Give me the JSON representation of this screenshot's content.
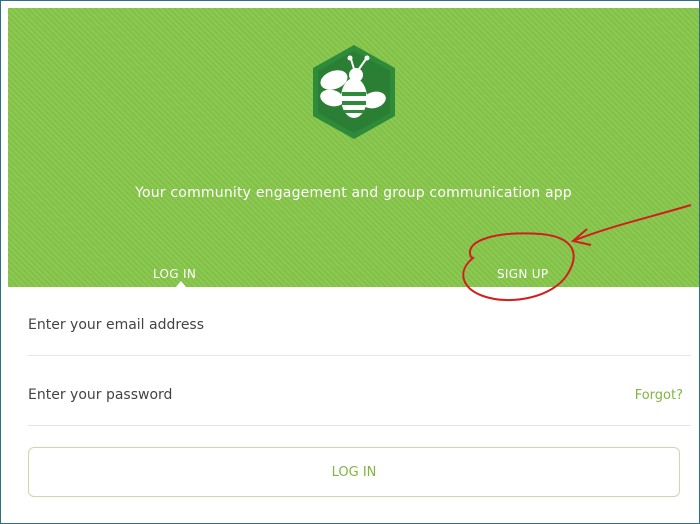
{
  "hero": {
    "tagline": "Your community engagement and group communication app",
    "logo_icon": "bee-hexagon-icon",
    "background_color": "#86c64a"
  },
  "tabs": [
    {
      "label": "LOG IN",
      "active": true
    },
    {
      "label": "SIGN UP",
      "active": false
    }
  ],
  "form": {
    "email_placeholder": "Enter your email address",
    "password_placeholder": "Enter your password",
    "forgot_label": "Forgot?",
    "login_button_label": "LOG IN"
  },
  "annotation": {
    "type": "red-circle-and-arrow",
    "target": "SIGN UP",
    "color": "#d11f1f"
  },
  "colors": {
    "accent_green": "#7fb542",
    "logo_green": "#2e8b3a"
  }
}
